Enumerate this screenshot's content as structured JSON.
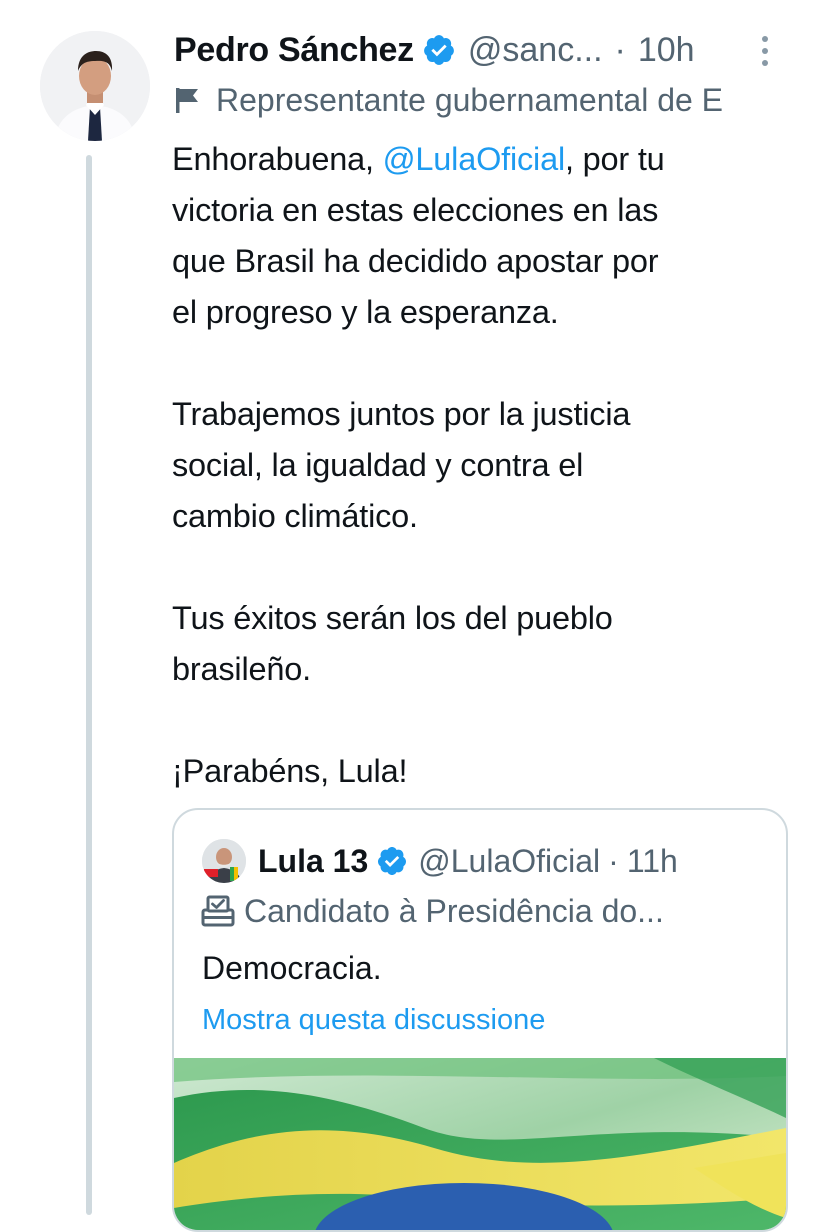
{
  "tweet": {
    "author_name": "Pedro Sánchez",
    "handle": "@sanc...",
    "separator": "·",
    "time": "10h",
    "label_text": "Representante gubernamental de E",
    "text_intro": "Enhorabuena, ",
    "mention": "@LulaOficial",
    "text_after_mention_line1": ", por tu",
    "text_lines_p1": [
      "victoria en estas elecciones en las",
      "que Brasil ha decidido apostar por",
      "el progreso y la esperanza."
    ],
    "text_p2": [
      "Trabajemos juntos por la justicia",
      "social, la igualdad y contra el",
      "cambio climático."
    ],
    "text_p3": [
      "Tus éxitos serán los del pueblo",
      "brasileño."
    ],
    "text_p4": "¡Parabéns, Lula!"
  },
  "quoted": {
    "author_name": "Lula 13",
    "handle": "@LulaOficial",
    "separator": "·",
    "time": "11h",
    "label_text": "Candidato à Presidência do...",
    "text": "Democracia.",
    "show_thread_link": "Mostra questa discussione"
  },
  "icons": {
    "verified": "verified-badge-icon",
    "flag": "government-flag-icon",
    "ballot": "ballot-box-icon",
    "more": "more-vertical-icon"
  },
  "colors": {
    "link": "#1d9bf0",
    "secondary_text": "#536471",
    "verified": "#1d9bf0",
    "thread_line": "#cfd9de"
  }
}
